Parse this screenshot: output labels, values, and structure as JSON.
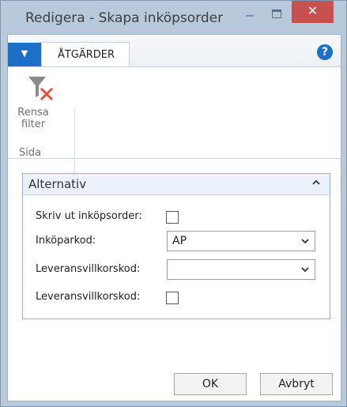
{
  "window": {
    "title": "Redigera - Skapa inköpsorder",
    "close_glyph": "✕"
  },
  "ribbon": {
    "menu_glyph": "▼",
    "tabs": [
      {
        "label": "ÅTGÄRDER"
      }
    ],
    "help_glyph": "?",
    "clear_filter_label": "Rensa filter",
    "group_label": "Sida"
  },
  "options_panel": {
    "title": "Alternativ",
    "fields": [
      {
        "label": "Skriv ut inköpsorder:",
        "type": "checkbox",
        "checked": false
      },
      {
        "label": "Inköparkod:",
        "type": "select",
        "value": "AP"
      },
      {
        "label": "Leveransvillkorskod:",
        "type": "select",
        "value": ""
      },
      {
        "label": "Leveransvillkorskod:",
        "type": "checkbox",
        "checked": false
      }
    ]
  },
  "footer": {
    "ok_label": "OK",
    "cancel_label": "Avbryt"
  }
}
